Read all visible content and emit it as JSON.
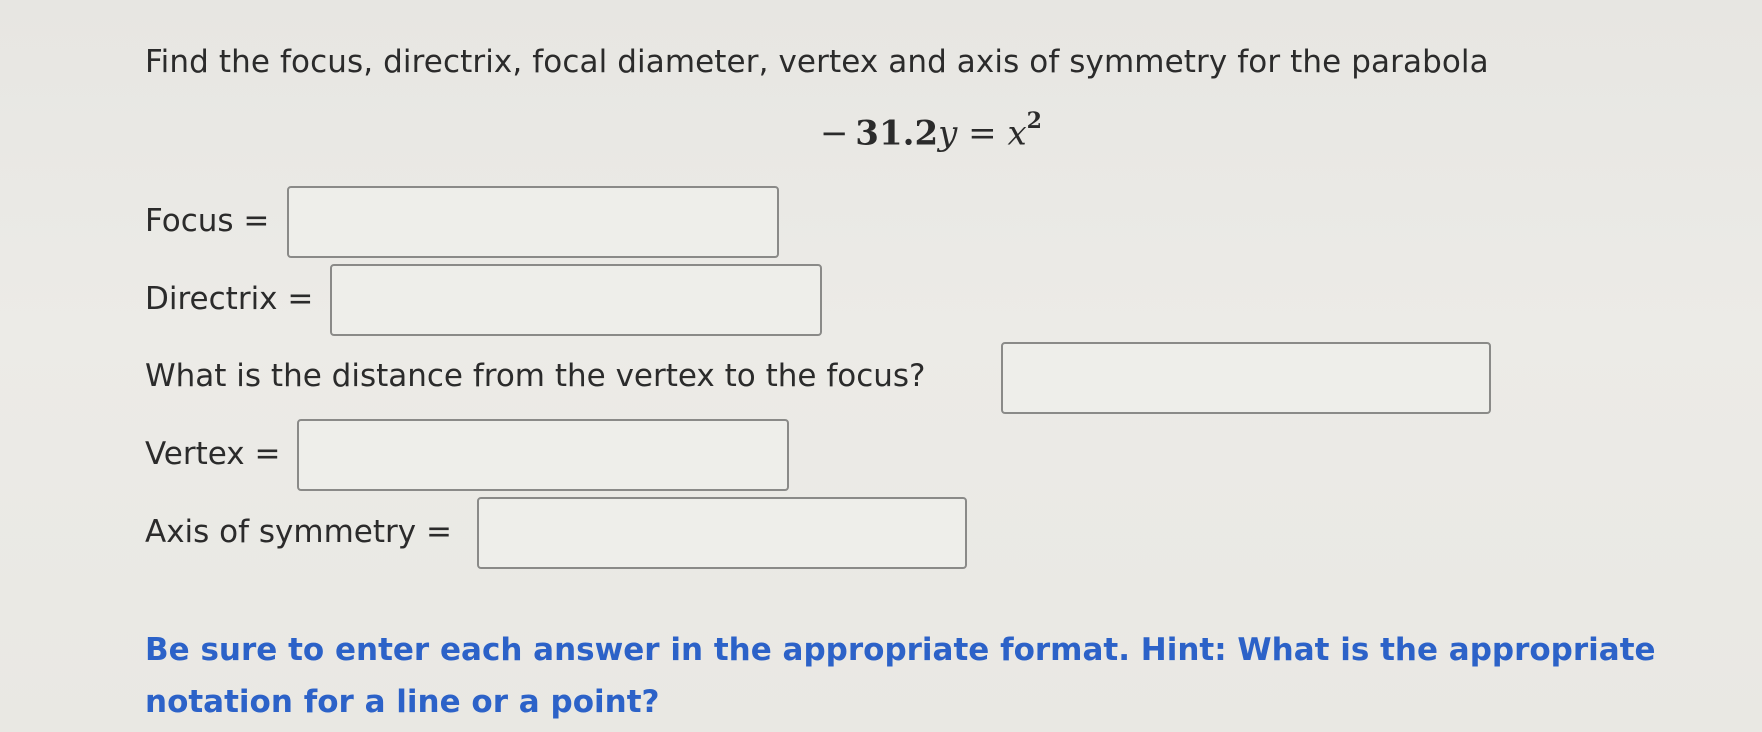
{
  "question": "Find the focus, directrix, focal diameter, vertex and axis of symmetry for the parabola",
  "equation": {
    "sign": "−",
    "coefficient": "31.2",
    "lhs_var": "y",
    "equals": "=",
    "rhs_var": "x",
    "exponent": "2"
  },
  "fields": {
    "focus": {
      "label": "Focus =",
      "value": ""
    },
    "directrix": {
      "label": "Directrix =",
      "value": ""
    },
    "distance": {
      "label": "What is the distance from the vertex to the focus?",
      "value": ""
    },
    "vertex": {
      "label": "Vertex =",
      "value": ""
    },
    "axis": {
      "label": "Axis of symmetry =",
      "value": ""
    }
  },
  "hint": "Be sure to enter each answer in the appropriate format. Hint: What is the appropriate notation for a line or a point?",
  "colors": {
    "hint": "#2c62c8",
    "text": "#2b2b2b",
    "box_border": "#8a8a88"
  }
}
